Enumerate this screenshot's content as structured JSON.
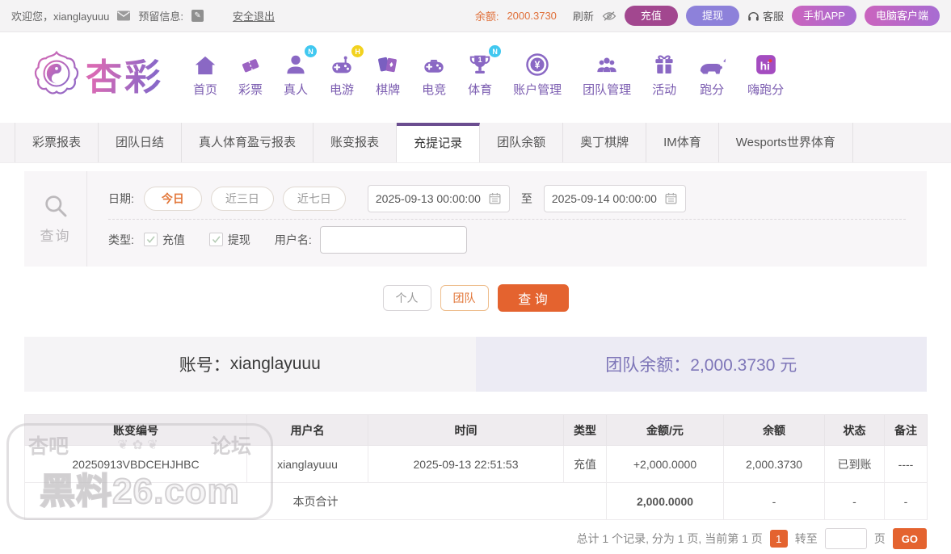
{
  "topbar": {
    "welcome": "欢迎您，xianglayuuu",
    "reserved_info_label": "预留信息:",
    "logout": "安全退出",
    "balance_label": "余额:",
    "balance_value": "2000.3730",
    "refresh_label": "刷新",
    "deposit_button": "充值",
    "withdraw_button": "提现",
    "service_label": "客服",
    "mobile_app_button": "手机APP",
    "pc_client_button": "电脑客户端"
  },
  "brand": {
    "logo_text": "杏彩"
  },
  "nav": {
    "items": [
      {
        "label": "首页",
        "badge": ""
      },
      {
        "label": "彩票",
        "badge": ""
      },
      {
        "label": "真人",
        "badge": "N"
      },
      {
        "label": "电游",
        "badge": "H"
      },
      {
        "label": "棋牌",
        "badge": ""
      },
      {
        "label": "电竞",
        "badge": ""
      },
      {
        "label": "体育",
        "badge": "N"
      },
      {
        "label": "账户管理",
        "badge": ""
      },
      {
        "label": "团队管理",
        "badge": ""
      },
      {
        "label": "活动",
        "badge": ""
      },
      {
        "label": "跑分",
        "badge": ""
      },
      {
        "label": "嗨跑分",
        "badge": ""
      }
    ]
  },
  "tabs": {
    "active": "充提记录",
    "items": [
      {
        "label": "彩票报表"
      },
      {
        "label": "团队日结"
      },
      {
        "label": "真人体育盈亏报表"
      },
      {
        "label": "账变报表"
      },
      {
        "label": "充提记录"
      },
      {
        "label": "团队余额"
      },
      {
        "label": "奥丁棋牌"
      },
      {
        "label": "IM体育"
      },
      {
        "label": "Wesports世界体育"
      }
    ]
  },
  "filter": {
    "search_label": "查询",
    "date_label": "日期:",
    "date_presets": [
      "今日",
      "近三日",
      "近七日"
    ],
    "active_preset": "今日",
    "date_from": "2025-09-13 00:00:00",
    "to_label": "至",
    "date_to": "2025-09-14 00:00:00",
    "type_label": "类型:",
    "type_deposit": "充值",
    "type_withdraw": "提现",
    "deposit_checked": true,
    "withdraw_checked": true,
    "username_label": "用户名:",
    "username_value": ""
  },
  "actions": {
    "personal_button": "个人",
    "team_button": "团队",
    "query_button": "查 询"
  },
  "account_bar": {
    "account_label": "账号：",
    "account_value": "xianglayuuu",
    "team_balance_label": "团队余额：",
    "team_balance_value": "2,000.3730 元"
  },
  "table": {
    "headers": [
      "账变编号",
      "用户名",
      "时间",
      "类型",
      "金额/元",
      "余额",
      "状态",
      "备注"
    ],
    "rows": [
      {
        "id": "20250913VBDCEHJHBC",
        "username": "xianglayuuu",
        "time": "2025-09-13 22:51:53",
        "type": "充值",
        "amount": "+2,000.0000",
        "balance": "2,000.3730",
        "status": "已到账",
        "remark": "----"
      }
    ],
    "total_row": {
      "label": "本页合计",
      "amount": "2,000.0000",
      "balance": "-",
      "status": "-",
      "remark": "-"
    }
  },
  "pagination": {
    "summary": "总计 1 个记录, 分为 1 页, 当前第 1 页",
    "current_page": "1",
    "goto_label": "转至",
    "page_label": "页",
    "go_button": "GO"
  },
  "watermark": {
    "line1_left": "杏吧",
    "line1_right": "论坛",
    "line2": "黑料26.com"
  },
  "colors": {
    "accent_orange": "#e4632f",
    "brand_purple": "#6b4d90",
    "nav_purple": "#7b5cb0",
    "success_green": "#61a332",
    "balance_purple": "#7e76b8",
    "deposit_button_bg": "#a2478f",
    "withdraw_button_bg": "#8d81da",
    "badge_n_bg": "#41c8f0",
    "badge_h_bg": "#f2d21f"
  }
}
